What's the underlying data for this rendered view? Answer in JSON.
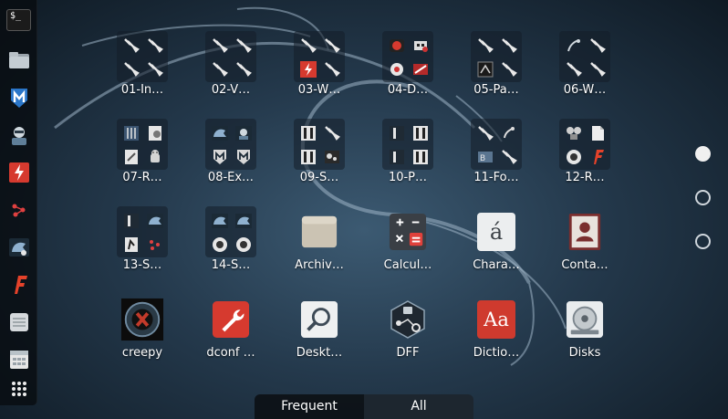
{
  "dock": {
    "items": [
      {
        "name": "terminal",
        "label": "$_"
      },
      {
        "name": "files"
      },
      {
        "name": "metasploit"
      },
      {
        "name": "armitage"
      },
      {
        "name": "burpsuite"
      },
      {
        "name": "maltego"
      },
      {
        "name": "beef-xss"
      },
      {
        "name": "faraday"
      },
      {
        "name": "leafpad"
      },
      {
        "name": "keepnote"
      },
      {
        "name": "show-applications"
      }
    ]
  },
  "apps": [
    {
      "label": "01-In…",
      "kind": "folder"
    },
    {
      "label": "02-V…",
      "kind": "folder"
    },
    {
      "label": "03-W…",
      "kind": "folder"
    },
    {
      "label": "04-D…",
      "kind": "folder"
    },
    {
      "label": "05-Pa…",
      "kind": "folder"
    },
    {
      "label": "06-W…",
      "kind": "folder"
    },
    {
      "label": "07-R…",
      "kind": "folder"
    },
    {
      "label": "08-Ex…",
      "kind": "folder"
    },
    {
      "label": "09-S…",
      "kind": "folder"
    },
    {
      "label": "10-P…",
      "kind": "folder"
    },
    {
      "label": "11-Fo…",
      "kind": "folder"
    },
    {
      "label": "12-R…",
      "kind": "folder"
    },
    {
      "label": "13-S…",
      "kind": "folder"
    },
    {
      "label": "14-S…",
      "kind": "folder"
    },
    {
      "label": "Archiv…",
      "kind": "archive"
    },
    {
      "label": "Calcul…",
      "kind": "calculator"
    },
    {
      "label": "Chara…",
      "kind": "characters"
    },
    {
      "label": "Conta…",
      "kind": "contacts"
    },
    {
      "label": "creepy",
      "kind": "creepy"
    },
    {
      "label": "dconf …",
      "kind": "dconf"
    },
    {
      "label": "Deskt…",
      "kind": "desktop-search"
    },
    {
      "label": "DFF",
      "kind": "dff"
    },
    {
      "label": "Dictio…",
      "kind": "dictionary"
    },
    {
      "label": "Disks",
      "kind": "disks"
    }
  ],
  "icon_glyphs": {
    "characters": "á",
    "dictionary": "Aa"
  },
  "pagination": {
    "pages": 3,
    "current": 1
  },
  "switcher": {
    "frequent_label": "Frequent",
    "all_label": "All",
    "selected": "All"
  },
  "colors": {
    "accent_red": "#d63a2f",
    "dock_bg": "#0a0e12"
  }
}
